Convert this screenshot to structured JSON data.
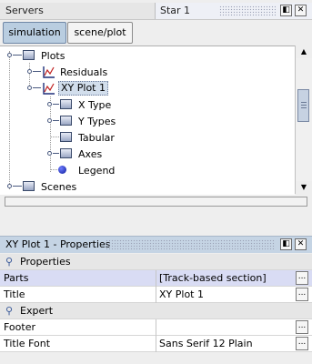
{
  "servers_panel": {
    "title": "Servers"
  },
  "sim_panel": {
    "title": "Star 1"
  },
  "window_buttons": {
    "restore": "◧",
    "close": "✕"
  },
  "tabs": [
    {
      "label": "simulation",
      "active": true
    },
    {
      "label": "scene/plot",
      "active": false
    }
  ],
  "tree": {
    "items": [
      {
        "label": "Plots"
      },
      {
        "label": "Residuals"
      },
      {
        "label": "XY Plot 1"
      },
      {
        "label": "X Type"
      },
      {
        "label": "Y Types"
      },
      {
        "label": "Tabular"
      },
      {
        "label": "Axes"
      },
      {
        "label": "Legend"
      },
      {
        "label": "Scenes"
      }
    ]
  },
  "properties": {
    "title": "XY Plot 1 - Properties",
    "group1": "Properties",
    "rows1": [
      {
        "name": "Parts",
        "value": "[Track-based section]"
      },
      {
        "name": "Title",
        "value": "XY Plot 1"
      }
    ],
    "group2": "Expert",
    "rows2": [
      {
        "name": "Footer",
        "value": ""
      },
      {
        "name": "Title Font",
        "value": "Sans Serif 12 Plain"
      }
    ],
    "ellipsis": "..."
  },
  "colors": {
    "selected_tab": "#b9cde0",
    "header_bg": "#c5d4e4",
    "selected_row": "#d9dcf4"
  }
}
